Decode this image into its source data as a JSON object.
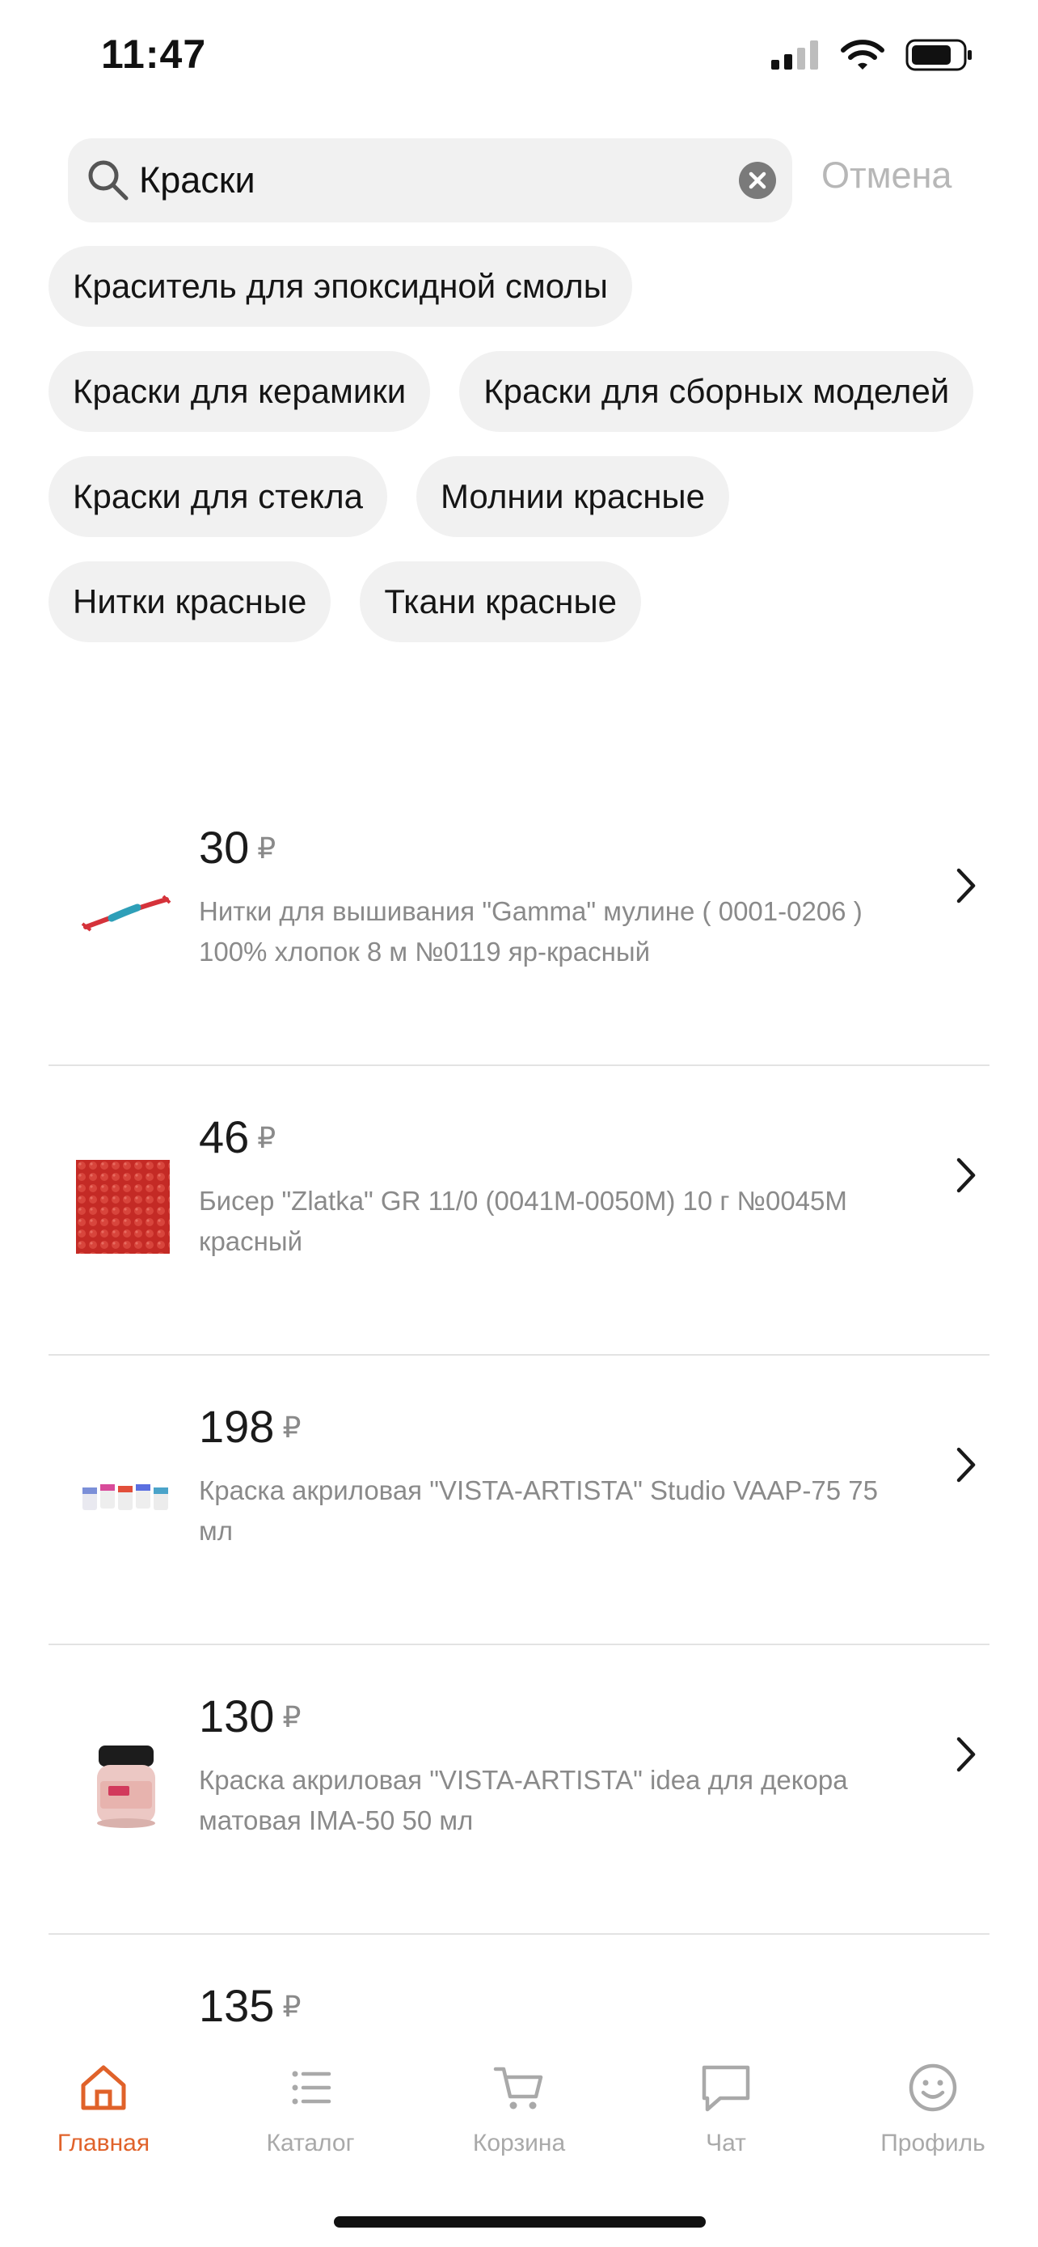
{
  "status": {
    "time": "11:47"
  },
  "search": {
    "value": "Краски",
    "cancel_label": "Отмена"
  },
  "chips": [
    "Краситель для эпоксидной смолы",
    "Краски для керамики",
    "Краски для сборных моделей",
    "Краски для стекла",
    "Молнии красные",
    "Нитки красные",
    "Ткани красные"
  ],
  "products": [
    {
      "price": "30",
      "currency": "₽",
      "title": "Нитки для вышивания \"Gamma\" мулине ( 0001-0206 ) 100% хлопок 8 м №0119 яр-красный"
    },
    {
      "price": "46",
      "currency": "₽",
      "title": "Бисер \"Zlatka\" GR 11/0 (0041M-0050M) 10 г №0045M красный"
    },
    {
      "price": "198",
      "currency": "₽",
      "title": "Краска акриловая \"VISTA-ARTISTA\" Studio VAAP-75 75 мл"
    },
    {
      "price": "130",
      "currency": "₽",
      "title": "Краска акриловая \"VISTA-ARTISTA\" idea для декора матовая IMA-50 50 мл"
    },
    {
      "price": "135",
      "currency": "₽",
      "title": ""
    }
  ],
  "nav": [
    {
      "label": "Главная",
      "icon": "home-icon",
      "active": true
    },
    {
      "label": "Каталог",
      "icon": "catalog-icon",
      "active": false
    },
    {
      "label": "Корзина",
      "icon": "cart-icon",
      "active": false
    },
    {
      "label": "Чат",
      "icon": "chat-icon",
      "active": false
    },
    {
      "label": "Профиль",
      "icon": "profile-icon",
      "active": false
    }
  ],
  "colors": {
    "accent": "#e0622a",
    "inactive": "#a9a9a9",
    "chip_bg": "#f1f1f1",
    "muted_text": "#8a8a8a"
  }
}
